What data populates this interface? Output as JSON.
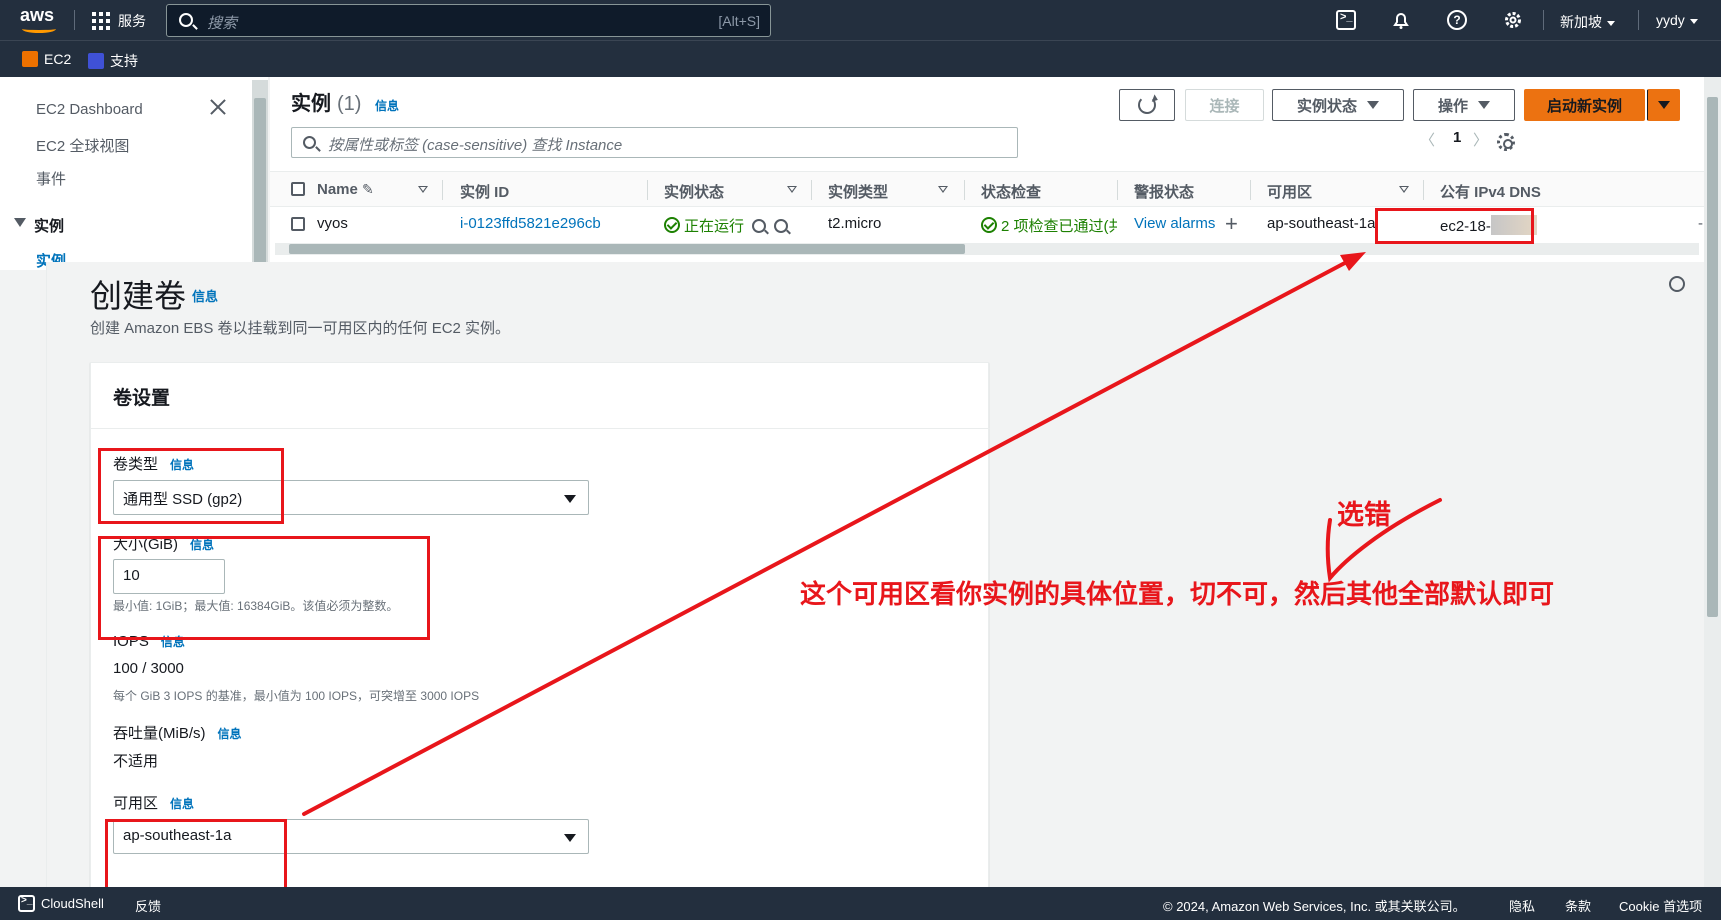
{
  "topnav": {
    "services_label": "服务",
    "search_placeholder": "搜索",
    "search_shortcut": "[Alt+S]",
    "region_label": "新加坡",
    "user_label": "yydy",
    "help_glyph": "?"
  },
  "subnav": {
    "items": [
      {
        "label": "EC2",
        "color": "#ed7100"
      },
      {
        "label": "支持",
        "color": "#3f51d6"
      }
    ]
  },
  "sidebar": {
    "items": [
      "EC2 Dashboard",
      "EC2 全球视图",
      "事件"
    ],
    "section": "实例",
    "active_item": "实例"
  },
  "instances": {
    "title": "实例",
    "count": "(1)",
    "info": "信息",
    "buttons": {
      "connect": "连接",
      "instance_state": "实例状态",
      "actions": "操作",
      "launch": "启动新实例"
    },
    "filter_placeholder": "按属性或标签 (case-sensitive) 查找 Instance",
    "page": "1",
    "prev": "〈",
    "next": "〉",
    "columns": [
      "Name",
      "实例 ID",
      "实例状态",
      "实例类型",
      "状态检查",
      "警报状态",
      "可用区",
      "公有 IPv4 DNS"
    ],
    "row": {
      "name": "vyos",
      "id": "i-0123ffd5821e296cb",
      "state": "正在运行",
      "type": "t2.micro",
      "checks": "2 项检查已通过(共",
      "alarms": "View alarms",
      "alarms_add": "+",
      "az": "ap-southeast-1a",
      "dns": "ec2-18-",
      "dns_tail": "-"
    }
  },
  "create_volume": {
    "title": "创建卷",
    "info": "信息",
    "description": "创建 Amazon EBS 卷以挂载到同一可用区内的任何 EC2 实例。",
    "section_title": "卷设置",
    "volume_type_label": "卷类型",
    "volume_type_value": "通用型 SSD (gp2)",
    "size_label": "大小(GiB)",
    "size_value": "10",
    "size_hint": "最小值: 1GiB；最大值: 16384GiB。该值必须为整数。",
    "iops_label": "IOPS",
    "iops_value": "100 / 3000",
    "iops_hint": "每个 GiB 3 IOPS 的基准，最小值为 100 IOPS，可突增至 3000 IOPS",
    "throughput_label": "吞吐量(MiB/s)",
    "throughput_value": "不适用",
    "az_label": "可用区",
    "az_value": "ap-southeast-1a"
  },
  "footer": {
    "cloudshell": "CloudShell",
    "feedback": "反馈",
    "copyright": "© 2024, Amazon Web Services, Inc. 或其关联公司。",
    "privacy": "隐私",
    "terms": "条款",
    "cookie": "Cookie 首选项"
  },
  "annotations": {
    "wrong_label": "选错",
    "note": "这个可用区看你实例的具体位置，切不可，然后其他全部默认即可",
    "color": "#e8161b"
  }
}
